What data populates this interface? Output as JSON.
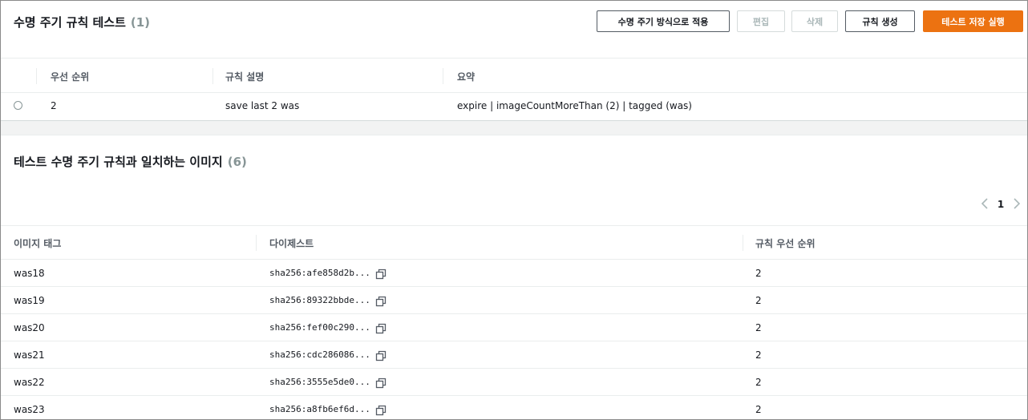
{
  "rules_panel": {
    "title": "수명 주기 규칙 테스트",
    "count": "(1)",
    "buttons": {
      "apply": "수명 주기 방식으로 적용",
      "edit": "편집",
      "delete": "삭제",
      "create": "규칙 생성",
      "save_run": "테스트 저장 실행"
    },
    "columns": {
      "priority": "우선 순위",
      "description": "규칙 설명",
      "summary": "요약"
    },
    "rows": [
      {
        "priority": "2",
        "description": "save last 2 was",
        "summary": "expire | imageCountMoreThan (2) | tagged (was)"
      }
    ]
  },
  "images_panel": {
    "title": "테스트 수명 주기 규칙과 일치하는 이미지",
    "count": "(6)",
    "pagination": {
      "current_page": "1"
    },
    "columns": {
      "tag": "이미지 태그",
      "digest": "다이제스트",
      "rule_priority": "규칙 우선 순위"
    },
    "rows": [
      {
        "tag": "was18",
        "digest": "sha256:afe858d2b...",
        "rule_priority": "2"
      },
      {
        "tag": "was19",
        "digest": "sha256:89322bbde...",
        "rule_priority": "2"
      },
      {
        "tag": "was20",
        "digest": "sha256:fef00c290...",
        "rule_priority": "2"
      },
      {
        "tag": "was21",
        "digest": "sha256:cdc286086...",
        "rule_priority": "2"
      },
      {
        "tag": "was22",
        "digest": "sha256:3555e5de0...",
        "rule_priority": "2"
      },
      {
        "tag": "was23",
        "digest": "sha256:a8fb6ef6d...",
        "rule_priority": "2"
      }
    ]
  },
  "colors": {
    "primary": "#ec7211",
    "text": "#16191f",
    "muted": "#879596",
    "disabled": "#aab7b8"
  }
}
